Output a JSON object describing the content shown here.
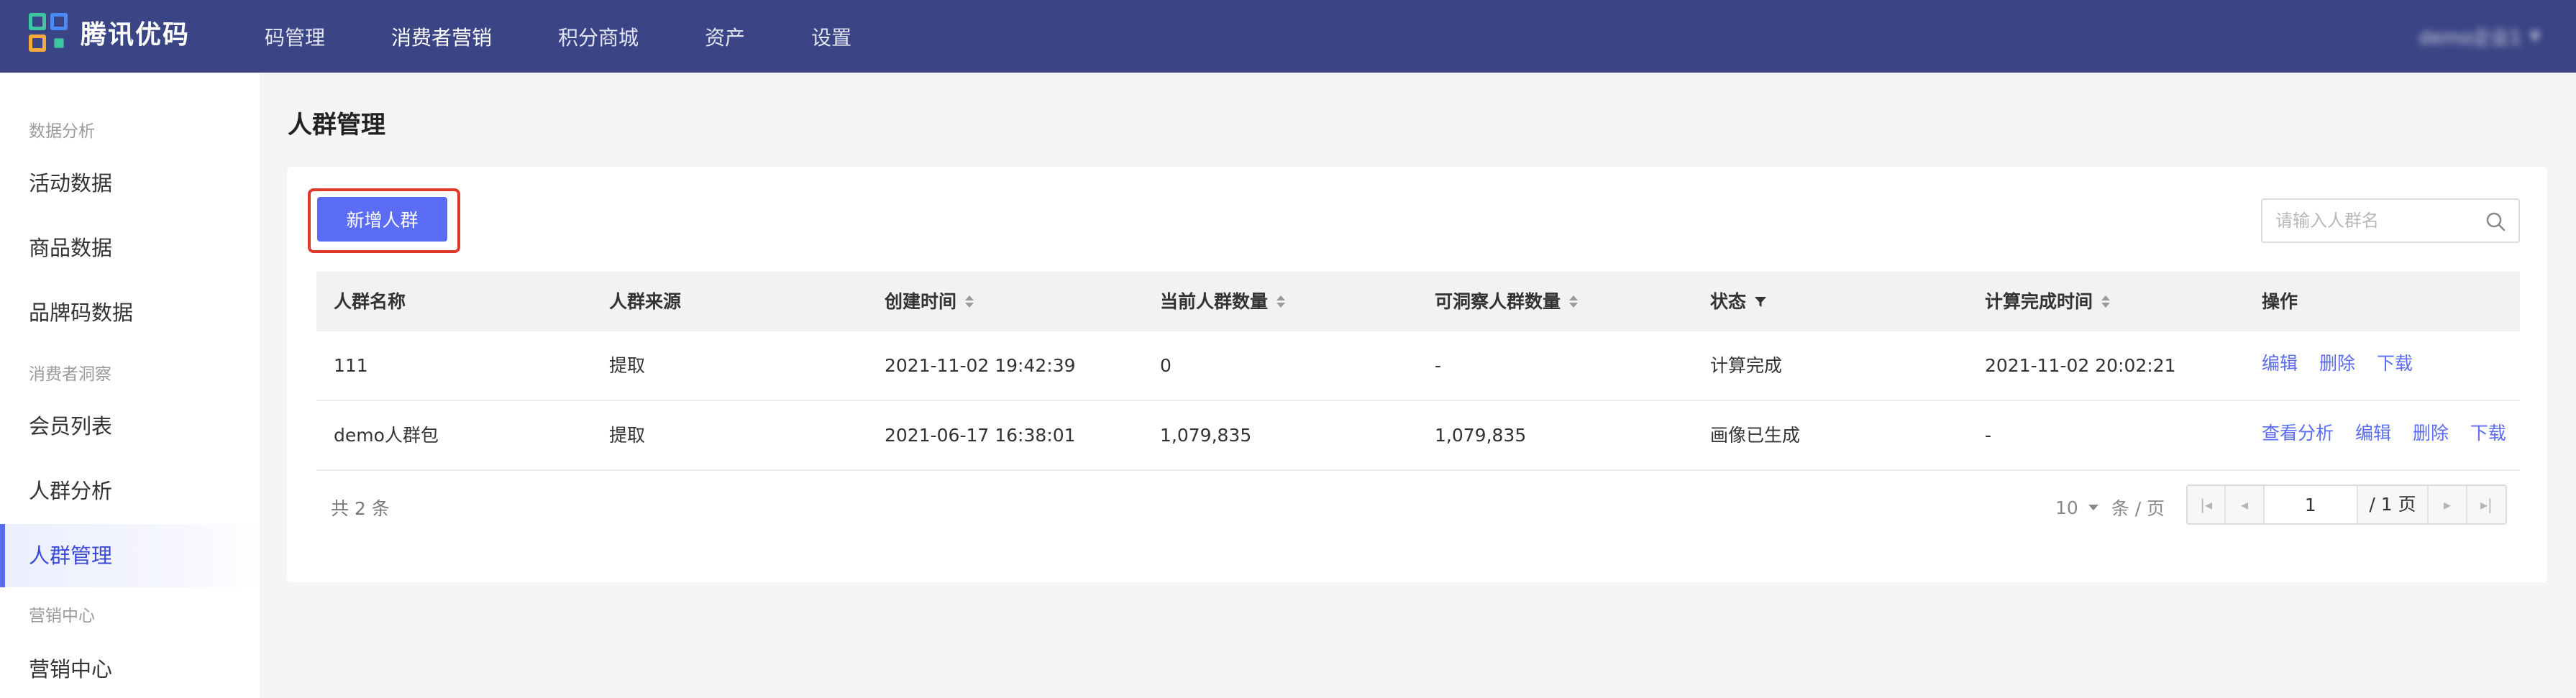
{
  "brand": {
    "name": "腾讯优码"
  },
  "topnav": {
    "items": [
      {
        "label": "码管理",
        "active": false
      },
      {
        "label": "消费者营销",
        "active": true
      },
      {
        "label": "积分商城",
        "active": false
      },
      {
        "label": "资产",
        "active": false
      },
      {
        "label": "设置",
        "active": false
      }
    ],
    "user": "demo企业1"
  },
  "sidebar": {
    "groups": [
      "数据分析",
      "消费者洞察",
      "营销中心"
    ],
    "items": [
      {
        "label": "活动数据"
      },
      {
        "label": "商品数据"
      },
      {
        "label": "品牌码数据"
      },
      {
        "label": "会员列表"
      },
      {
        "label": "人群分析"
      },
      {
        "label": "人群管理",
        "active": true
      },
      {
        "label": "营销中心"
      }
    ]
  },
  "page": {
    "title": "人群管理",
    "add_button": "新增人群",
    "search_placeholder": "请输入人群名"
  },
  "table": {
    "columns": [
      "人群名称",
      "人群来源",
      "创建时间",
      "当前人群数量",
      "可洞察人群数量",
      "状态",
      "计算完成时间",
      "操作"
    ],
    "rows": [
      {
        "name": "111",
        "source": "提取",
        "created": "2021-11-02 19:42:39",
        "current": "0",
        "insight": "-",
        "status": "计算完成",
        "finished": "2021-11-02 20:02:21",
        "actions": [
          "编辑",
          "删除",
          "下载"
        ]
      },
      {
        "name": "demo人群包",
        "source": "提取",
        "created": "2021-06-17 16:38:01",
        "current": "1,079,835",
        "insight": "1,079,835",
        "status": "画像已生成",
        "finished": "-",
        "actions": [
          "查看分析",
          "编辑",
          "删除",
          "下载"
        ]
      }
    ]
  },
  "pagination": {
    "total": "共 2 条",
    "page_size": "10",
    "page_size_unit": "条 / 页",
    "current_page": "1",
    "total_pages": "/ 1 页"
  },
  "colors": {
    "nav_bg": "#3b4585",
    "accent": "#5b6cf7",
    "highlight_border": "#e0392b"
  }
}
